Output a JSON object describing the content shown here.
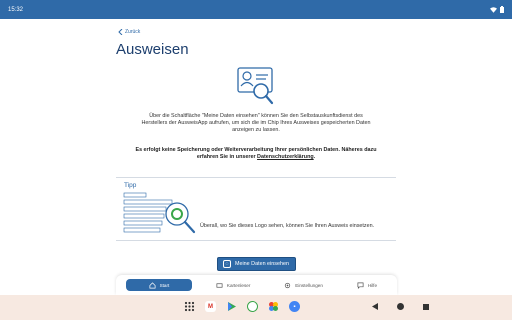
{
  "status": {
    "time": "15:32"
  },
  "page": {
    "back_label": "Zurück",
    "title": "Ausweisen",
    "intro": "Über die Schaltfläche \"Meine Daten einsehen\" können Sie den Selbstauskunftsdienst des Herstellers der AusweisApp aufrufen, um sich die im Chip Ihres Ausweises gespeicherten Daten anzeigen zu lassen.",
    "notice_part1": "Es erfolgt keine Speicherung oder Weiterverarbeitung Ihrer persönlichen Daten. Näheres dazu erfahren Sie in unserer ",
    "notice_link": "Datenschutzerklärung",
    "notice_end": ".",
    "tip_label": "Tipp",
    "tip_text": "Überall, wo Sie dieses Logo sehen, können Sie Ihren Ausweis einsetzen.",
    "button_label": "Meine Daten einsehen"
  },
  "nav": {
    "items": [
      {
        "label": "Start",
        "icon": "home-icon",
        "active": true
      },
      {
        "label": "Kartenleser",
        "icon": "card-reader-icon",
        "active": false
      },
      {
        "label": "Einstellungen",
        "icon": "gear-icon",
        "active": false
      },
      {
        "label": "Hilfe",
        "icon": "help-icon",
        "active": false
      }
    ]
  },
  "colors": {
    "accent": "#2f6aa8",
    "status_bar": "#2f6aa8",
    "system_bar": "#f7e9e1"
  }
}
